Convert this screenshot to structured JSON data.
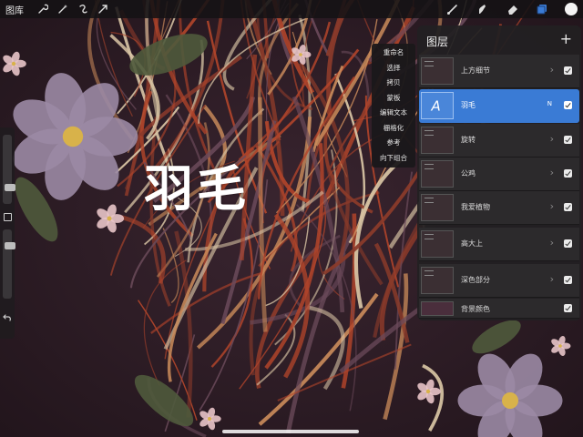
{
  "topbar": {
    "gallery_label": "图库",
    "left_tools": [
      "wrench-icon",
      "magic-wand-icon",
      "selection-icon",
      "transform-arrow-icon"
    ],
    "right_tools": [
      "brush-icon",
      "smudge-icon",
      "eraser-icon",
      "layers-icon"
    ],
    "color_swatch": "#f4f4f4"
  },
  "canvas": {
    "text": "羽毛",
    "palette": {
      "background": "#2a1a22",
      "feather_red": "#b0442a",
      "feather_cream": "#d9c5a5",
      "flower_purple": "#9b8aa4",
      "leaf_green": "#4f5a3c",
      "blossom_pink": "#e8c4c8"
    }
  },
  "context_menu": {
    "items": [
      "重命名",
      "选择",
      "拷贝",
      "蒙板",
      "编辑文本",
      "栅格化",
      "参考",
      "向下组合"
    ]
  },
  "layers_panel": {
    "title": "图层",
    "add_label": "+",
    "layers": [
      {
        "name": "上方细节",
        "selected": false,
        "visible": true,
        "blend": ""
      },
      {
        "name": "羽毛",
        "selected": true,
        "visible": true,
        "blend": "N",
        "is_text": true
      },
      {
        "name": "旋转",
        "selected": false,
        "visible": true,
        "blend": ""
      },
      {
        "name": "公鸡",
        "selected": false,
        "visible": true,
        "blend": ""
      },
      {
        "name": "我爱植物",
        "selected": false,
        "visible": true,
        "blend": ""
      },
      {
        "name": "高大上",
        "selected": false,
        "visible": true,
        "blend": ""
      },
      {
        "name": "深色部分",
        "selected": false,
        "visible": true,
        "blend": ""
      }
    ],
    "background_layer": {
      "name": "背景颜色",
      "visible": true,
      "color": "#4a2e3c"
    },
    "selected_color": "#3a7bd5"
  },
  "sidebar": {
    "brush_size_level": 0.2,
    "opacity_level": 0.8
  }
}
